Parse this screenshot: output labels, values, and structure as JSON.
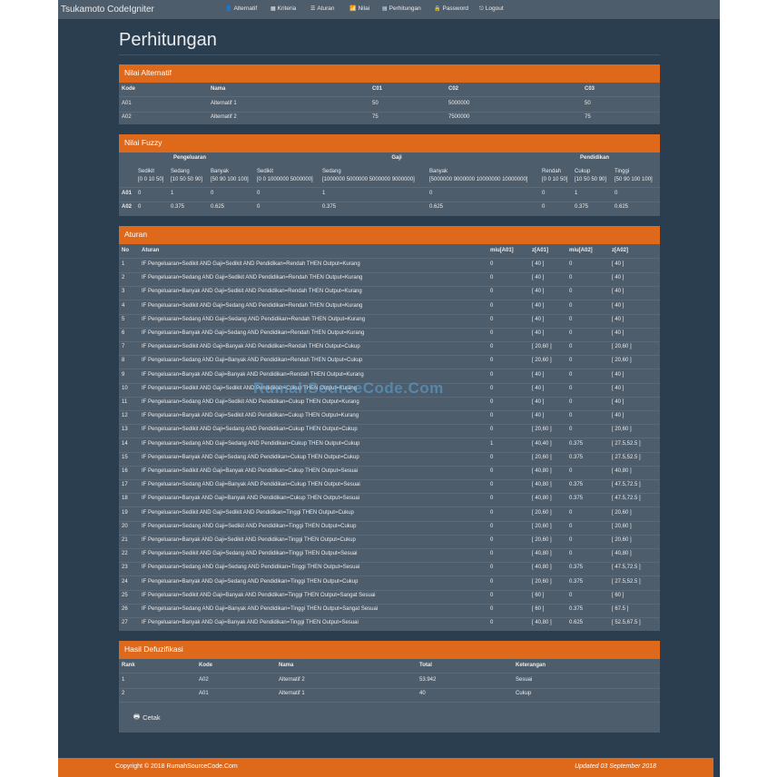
{
  "nav": {
    "brand": "Tsukamoto CodeIgniter",
    "items": [
      {
        "label": "Alternatif",
        "icon": "👤"
      },
      {
        "label": "Kriteria",
        "icon": "▦"
      },
      {
        "label": "Aturan",
        "icon": "☰"
      },
      {
        "label": "Nilai",
        "icon": "📶"
      },
      {
        "label": "Perhitungan",
        "icon": "▤"
      },
      {
        "label": "Password",
        "icon": "🔒"
      },
      {
        "label": "Logout",
        "icon": "⎋"
      }
    ]
  },
  "page_title": "Perhitungan",
  "alternatif": {
    "title": "Nilai Alternatif",
    "headers": [
      "Kode",
      "Nama",
      "C01",
      "C02",
      "C03"
    ],
    "rows": [
      [
        "A01",
        "Alternatif 1",
        "50",
        "5000000",
        "50"
      ],
      [
        "A02",
        "Alternatif 2",
        "75",
        "7500000",
        "75"
      ]
    ]
  },
  "fuzzy": {
    "title": "Nilai Fuzzy",
    "groups": [
      "Pengeluaran",
      "Gaji",
      "Pendidikan"
    ],
    "subheaders": [
      {
        "name": "Sedikit",
        "range": "[0 0 10 50]"
      },
      {
        "name": "Sedang",
        "range": "[10 50 50 90]"
      },
      {
        "name": "Banyak",
        "range": "[50 90 100 100]"
      },
      {
        "name": "Sedikit",
        "range": "[0 0 1000000 5000000]"
      },
      {
        "name": "Sedang",
        "range": "[1000000 5000000 5000000 9000000]"
      },
      {
        "name": "Banyak",
        "range": "[5000000 9000000 10000000 10000000]"
      },
      {
        "name": "Rendah",
        "range": "[0 0 10 50]"
      },
      {
        "name": "Cukup",
        "range": "[10 50 50 90]"
      },
      {
        "name": "Tinggi",
        "range": "[50 90 100 100]"
      }
    ],
    "rows": [
      {
        "kode": "A01",
        "values": [
          "0",
          "1",
          "0",
          "0",
          "1",
          "0",
          "0",
          "1",
          "0"
        ]
      },
      {
        "kode": "A02",
        "values": [
          "0",
          "0.375",
          "0.625",
          "0",
          "0.375",
          "0.625",
          "0",
          "0.375",
          "0.625"
        ]
      }
    ]
  },
  "aturan": {
    "title": "Aturan",
    "headers": [
      "No",
      "Aturan",
      "miu[A01]",
      "z[A01]",
      "miu[A02]",
      "z[A02]"
    ],
    "rows": [
      [
        "1",
        "IF Pengeluaran=Sedikit AND Gaji=Sedikit AND Pendidikan=Rendah THEN Output=Kurang",
        "0",
        "[ 40 ]",
        "0",
        "[ 40 ]"
      ],
      [
        "2",
        "IF Pengeluaran=Sedang AND Gaji=Sedikit AND Pendidikan=Rendah THEN Output=Kurang",
        "0",
        "[ 40 ]",
        "0",
        "[ 40 ]"
      ],
      [
        "3",
        "IF Pengeluaran=Banyak AND Gaji=Sedikit AND Pendidikan=Rendah THEN Output=Kurang",
        "0",
        "[ 40 ]",
        "0",
        "[ 40 ]"
      ],
      [
        "4",
        "IF Pengeluaran=Sedikit AND Gaji=Sedang AND Pendidikan=Rendah THEN Output=Kurang",
        "0",
        "[ 40 ]",
        "0",
        "[ 40 ]"
      ],
      [
        "5",
        "IF Pengeluaran=Sedang AND Gaji=Sedang AND Pendidikan=Rendah THEN Output=Kurang",
        "0",
        "[ 40 ]",
        "0",
        "[ 40 ]"
      ],
      [
        "6",
        "IF Pengeluaran=Banyak AND Gaji=Sedang AND Pendidikan=Rendah THEN Output=Kurang",
        "0",
        "[ 40 ]",
        "0",
        "[ 40 ]"
      ],
      [
        "7",
        "IF Pengeluaran=Sedikit AND Gaji=Banyak AND Pendidikan=Rendah THEN Output=Cukup",
        "0",
        "[ 20,60 ]",
        "0",
        "[ 20,60 ]"
      ],
      [
        "8",
        "IF Pengeluaran=Sedang AND Gaji=Banyak AND Pendidikan=Rendah THEN Output=Cukup",
        "0",
        "[ 20,60 ]",
        "0",
        "[ 20,60 ]"
      ],
      [
        "9",
        "IF Pengeluaran=Banyak AND Gaji=Banyak AND Pendidikan=Rendah THEN Output=Kurang",
        "0",
        "[ 40 ]",
        "0",
        "[ 40 ]"
      ],
      [
        "10",
        "IF Pengeluaran=Sedikit AND Gaji=Sedikit AND Pendidikan=Cukup THEN Output=Kurang",
        "0",
        "[ 40 ]",
        "0",
        "[ 40 ]"
      ],
      [
        "11",
        "IF Pengeluaran=Sedang AND Gaji=Sedikit AND Pendidikan=Cukup THEN Output=Kurang",
        "0",
        "[ 40 ]",
        "0",
        "[ 40 ]"
      ],
      [
        "12",
        "IF Pengeluaran=Banyak AND Gaji=Sedikit AND Pendidikan=Cukup THEN Output=Kurang",
        "0",
        "[ 40 ]",
        "0",
        "[ 40 ]"
      ],
      [
        "13",
        "IF Pengeluaran=Sedikit AND Gaji=Sedang AND Pendidikan=Cukup THEN Output=Cukup",
        "0",
        "[ 20,60 ]",
        "0",
        "[ 20,60 ]"
      ],
      [
        "14",
        "IF Pengeluaran=Sedang AND Gaji=Sedang AND Pendidikan=Cukup THEN Output=Cukup",
        "1",
        "[ 40,40 ]",
        "0.375",
        "[ 27.5,52.5 ]"
      ],
      [
        "15",
        "IF Pengeluaran=Banyak AND Gaji=Sedang AND Pendidikan=Cukup THEN Output=Cukup",
        "0",
        "[ 20,60 ]",
        "0.375",
        "[ 27.5,52.5 ]"
      ],
      [
        "16",
        "IF Pengeluaran=Sedikit AND Gaji=Banyak AND Pendidikan=Cukup THEN Output=Sesuai",
        "0",
        "[ 40,80 ]",
        "0",
        "[ 40,80 ]"
      ],
      [
        "17",
        "IF Pengeluaran=Sedang AND Gaji=Banyak AND Pendidikan=Cukup THEN Output=Sesuai",
        "0",
        "[ 40,80 ]",
        "0.375",
        "[ 47.5,72.5 ]"
      ],
      [
        "18",
        "IF Pengeluaran=Banyak AND Gaji=Banyak AND Pendidikan=Cukup THEN Output=Sesuai",
        "0",
        "[ 40,80 ]",
        "0.375",
        "[ 47.5,72.5 ]"
      ],
      [
        "19",
        "IF Pengeluaran=Sedikit AND Gaji=Sedikit AND Pendidikan=Tinggi THEN Output=Cukup",
        "0",
        "[ 20,60 ]",
        "0",
        "[ 20,60 ]"
      ],
      [
        "20",
        "IF Pengeluaran=Sedang AND Gaji=Sedikit AND Pendidikan=Tinggi THEN Output=Cukup",
        "0",
        "[ 20,60 ]",
        "0",
        "[ 20,60 ]"
      ],
      [
        "21",
        "IF Pengeluaran=Banyak AND Gaji=Sedikit AND Pendidikan=Tinggi THEN Output=Cukup",
        "0",
        "[ 20,60 ]",
        "0",
        "[ 20,60 ]"
      ],
      [
        "22",
        "IF Pengeluaran=Sedikit AND Gaji=Sedang AND Pendidikan=Tinggi THEN Output=Sesuai",
        "0",
        "[ 40,80 ]",
        "0",
        "[ 40,80 ]"
      ],
      [
        "23",
        "IF Pengeluaran=Sedang AND Gaji=Sedang AND Pendidikan=Tinggi THEN Output=Sesuai",
        "0",
        "[ 40,80 ]",
        "0.375",
        "[ 47.5,72.5 ]"
      ],
      [
        "24",
        "IF Pengeluaran=Banyak AND Gaji=Sedang AND Pendidikan=Tinggi THEN Output=Cukup",
        "0",
        "[ 20,60 ]",
        "0.375",
        "[ 27.5,52.5 ]"
      ],
      [
        "25",
        "IF Pengeluaran=Sedikit AND Gaji=Banyak AND Pendidikan=Tinggi THEN Output=Sangat Sesuai",
        "0",
        "[ 60 ]",
        "0",
        "[ 60 ]"
      ],
      [
        "26",
        "IF Pengeluaran=Sedang AND Gaji=Banyak AND Pendidikan=Tinggi THEN Output=Sangat Sesuai",
        "0",
        "[ 60 ]",
        "0.375",
        "[ 67.5 ]"
      ],
      [
        "27",
        "IF Pengeluaran=Banyak AND Gaji=Banyak AND Pendidikan=Tinggi THEN Output=Sesuai",
        "0",
        "[ 40,80 ]",
        "0.625",
        "[ 52.5,67.5 ]"
      ]
    ]
  },
  "hasil": {
    "title": "Hasil Defuzifikasi",
    "headers": [
      "Rank",
      "Kode",
      "Nama",
      "Total",
      "Keterangan"
    ],
    "rows": [
      [
        "1",
        "A02",
        "Alternatif 2",
        "53.942",
        "Sesuai"
      ],
      [
        "2",
        "A01",
        "Alternatif 1",
        "40",
        "Cukup"
      ]
    ],
    "print_label": "Cetak"
  },
  "footer": {
    "copyright": "Copyright © 2018 RumahSourceCode.Com",
    "updated": "Updated 03 September 2018"
  },
  "watermark": "RumahSourceCode.Com",
  "colors": {
    "accent": "#df691a",
    "background": "#2b3e50",
    "panel": "#4e5d6c"
  }
}
